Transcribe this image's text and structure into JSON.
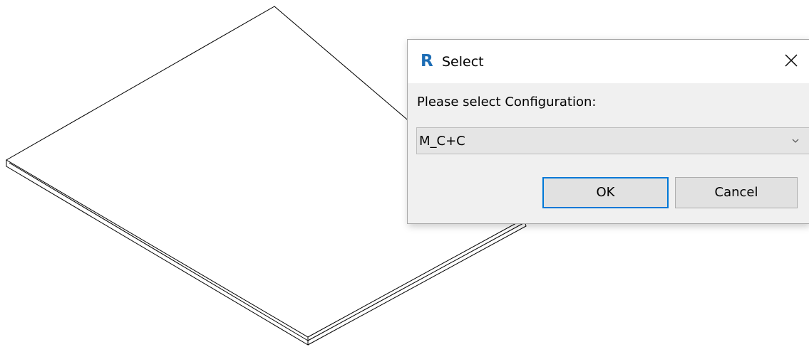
{
  "dialog": {
    "app_icon_letter": "R",
    "title": "Select",
    "close_glyph": "close-icon",
    "prompt": "Please select Configuration:",
    "combo": {
      "selected": "M_C+C",
      "arrow_icon": "chevron-down-icon"
    },
    "ok_label": "OK",
    "cancel_label": "Cancel"
  },
  "colors": {
    "app_icon": "#1d6db5",
    "default_button_border": "#0078d7",
    "dialog_bg": "#f0f0f0"
  }
}
